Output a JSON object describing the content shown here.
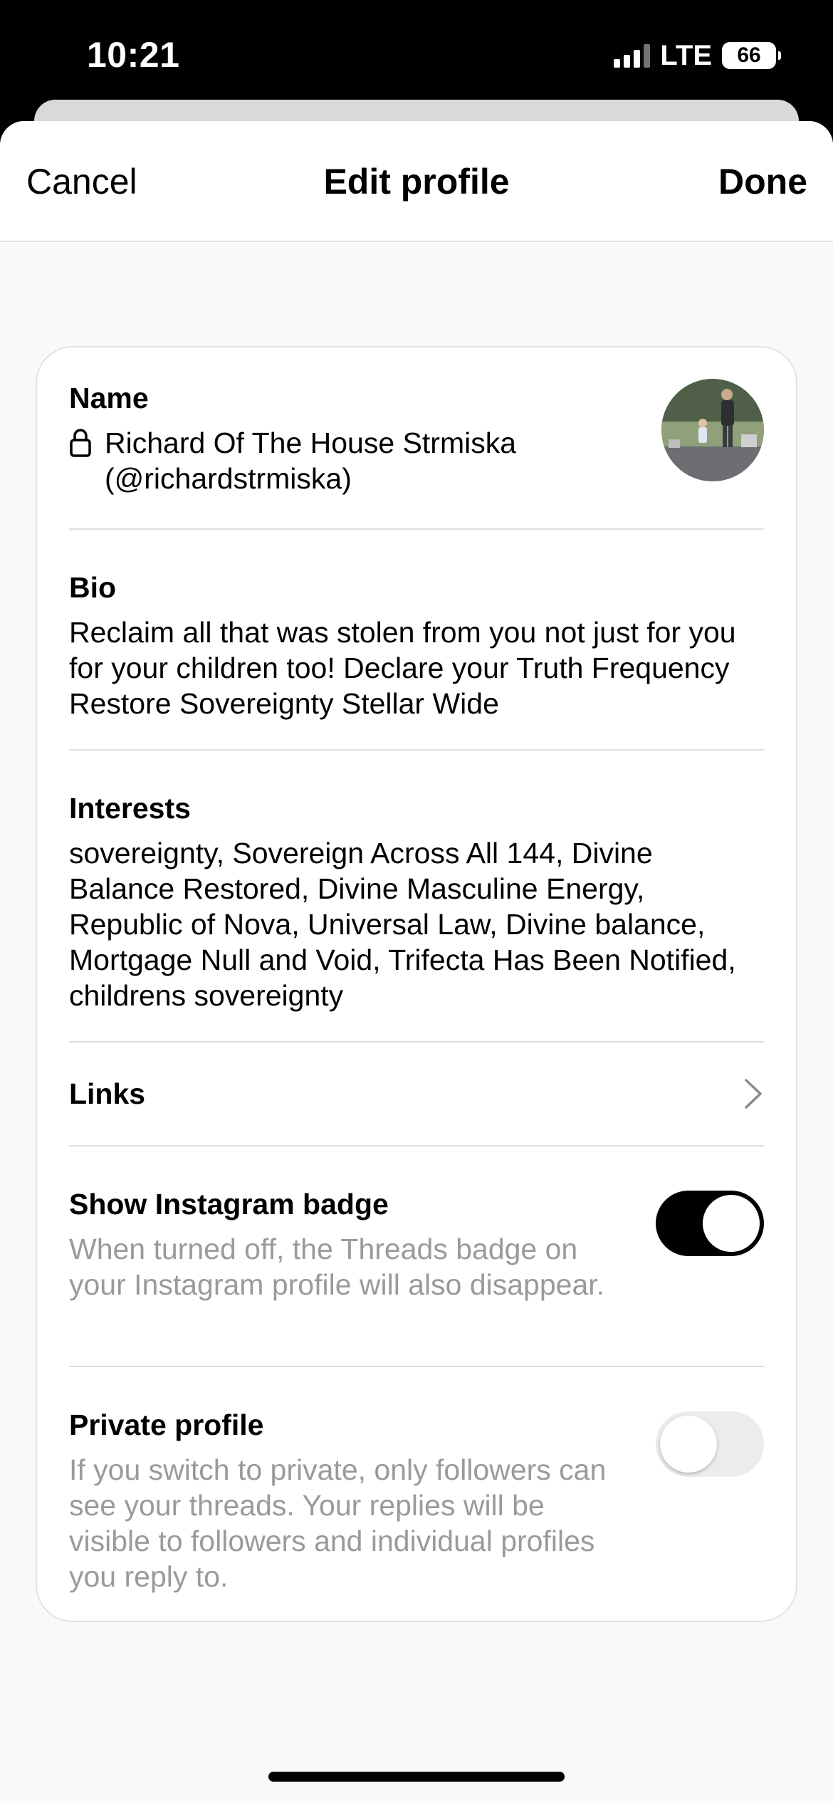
{
  "status_bar": {
    "time": "10:21",
    "network": "LTE",
    "battery": "66"
  },
  "nav": {
    "cancel_label": "Cancel",
    "title": "Edit profile",
    "done_label": "Done"
  },
  "profile": {
    "name_label": "Name",
    "name_value": "Richard Of The House Strmiska (@richardstrmiska)",
    "bio_label": "Bio",
    "bio_value": "Reclaim all that was stolen from you not just for you for your children too!  Declare your Truth Frequency Restore Sovereignty Stellar Wide",
    "interests_label": "Interests",
    "interests_value": "sovereignty, Sovereign Across All 144, Divine Balance Restored, Divine Masculine Energy, Republic of Nova, Universal Law, Divine balance, Mortgage Null and Void, Trifecta Has Been Notified, childrens sovereignty",
    "links_label": "Links",
    "badge_label": "Show Instagram badge",
    "badge_description": "When turned off, the Threads badge on your Instagram profile will also disappear.",
    "badge_enabled": true,
    "private_label": "Private profile",
    "private_description": "If you switch to private, only followers can see your threads. Your replies will be visible to followers and individual profiles you reply to.",
    "private_enabled": false
  },
  "colors": {
    "toggle_on": "#000000",
    "toggle_off": "#ececec",
    "muted_text": "#9a9a9a"
  }
}
